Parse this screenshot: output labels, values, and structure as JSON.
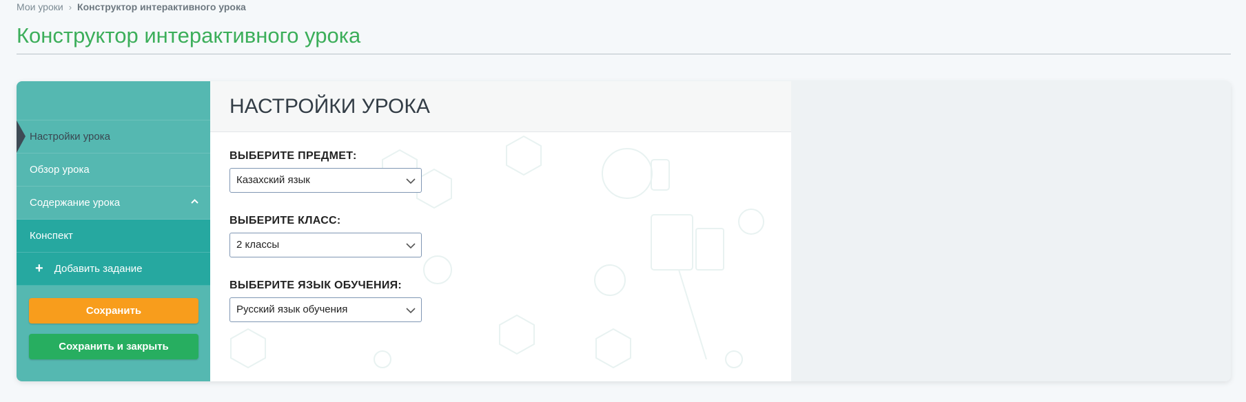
{
  "breadcrumb": {
    "items": [
      "Мои уроки",
      "Конструктор интерактивного урока"
    ],
    "separator": "›"
  },
  "page_title": "Конструктор интерактивного урока",
  "sidebar": {
    "items": [
      {
        "label": "Настройки урока"
      },
      {
        "label": "Обзор урока"
      },
      {
        "label": "Содержание урока"
      },
      {
        "label": "Конспект"
      },
      {
        "label": "Добавить задание",
        "icon": "plus-icon"
      }
    ],
    "active_index": 0,
    "save_label": "Сохранить",
    "save_close_label": "Сохранить и закрыть"
  },
  "main": {
    "heading": "НАСТРОЙКИ УРОКА",
    "fields": [
      {
        "label": "ВЫБЕРИТЕ ПРЕДМЕТ:",
        "value": "Казахский язык"
      },
      {
        "label": "ВЫБЕРИТЕ КЛАСС:",
        "value": "2 классы"
      },
      {
        "label": "ВЫБЕРИТЕ ЯЗЫК ОБУЧЕНИЯ:",
        "value": "Русский язык обучения"
      }
    ]
  },
  "colors": {
    "title_green": "#3cae5a",
    "sidebar_teal": "#55b8b1",
    "sidebar_sub_teal": "#26a8a0",
    "save_orange": "#f89d1c",
    "save_close_green": "#27ae60"
  }
}
